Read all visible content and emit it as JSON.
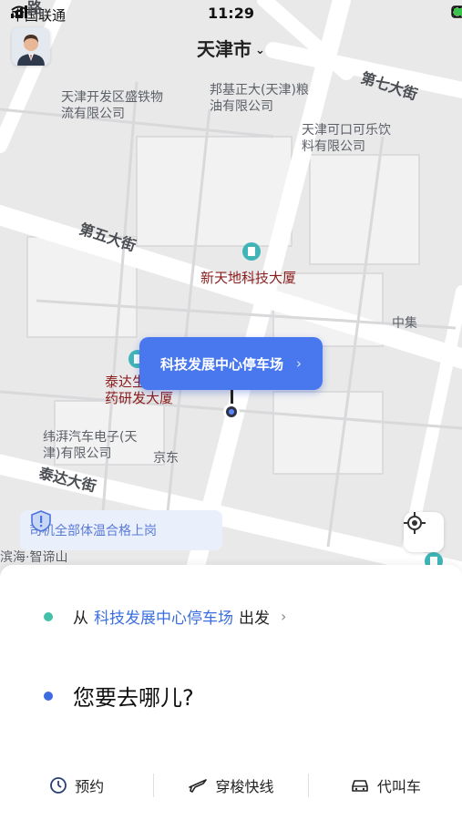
{
  "status_bar": {
    "carrier": "中国联通",
    "time": "11:29"
  },
  "header": {
    "city": "天津市",
    "city_chevron": "⌄"
  },
  "map": {
    "labels": {
      "tianjin_kaifa": "天津开发区盛铁物流有限公司",
      "bangji": "邦基正大(天津)粮油有限公司",
      "coke": "天津可口可乐饮料有限公司",
      "xintiandi": "新天地科技大厦",
      "zhongji": "中集",
      "taida_pharma": "泰达生物医药研发大厦",
      "weiping": "纬湃汽车电子(天津)有限公司",
      "jingdong": "京东",
      "bhai": "滨海·智谛山",
      "road_7th": "第七大街",
      "road_5th": "第五大街",
      "road_taida": "泰达大街",
      "road_side": "路"
    }
  },
  "pin": {
    "label": "科技发展中心停车场",
    "arrow": "›"
  },
  "notice": {
    "text": "司机全部体温合格上岗"
  },
  "sheet": {
    "from_prefix": "从",
    "from_location": "科技发展中心停车场",
    "from_suffix": "出发",
    "from_chevron": "›",
    "destination_prompt": "您要去哪儿?"
  },
  "tabs": [
    {
      "label": "预约",
      "icon": "clock-icon"
    },
    {
      "label": "穿梭快线",
      "icon": "plane-icon"
    },
    {
      "label": "代叫车",
      "icon": "car-icon"
    }
  ],
  "colors": {
    "accent": "#4877ee",
    "from_dot": "#45c0a8",
    "to_dot": "#3d6be0",
    "poi_text": "#8b1c1c"
  }
}
